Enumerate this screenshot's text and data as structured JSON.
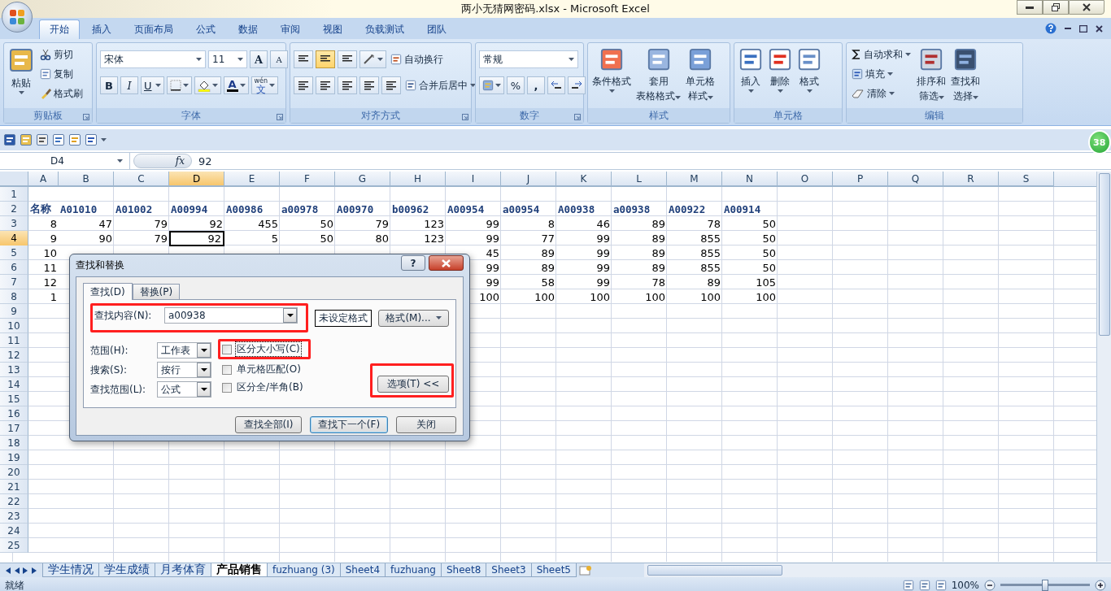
{
  "title_bar": {
    "title": "两小无猜网密码.xlsx - Microsoft Excel"
  },
  "ribbon_tabs": [
    {
      "label": "开始",
      "selected": true
    },
    {
      "label": "插入",
      "selected": false
    },
    {
      "label": "页面布局",
      "selected": false
    },
    {
      "label": "公式",
      "selected": false
    },
    {
      "label": "数据",
      "selected": false
    },
    {
      "label": "审阅",
      "selected": false
    },
    {
      "label": "视图",
      "selected": false
    },
    {
      "label": "负载测试",
      "selected": false
    },
    {
      "label": "团队",
      "selected": false
    }
  ],
  "clipboard": {
    "label": "剪贴板",
    "paste": "粘贴",
    "cut": "剪切",
    "copy": "复制",
    "format_painter": "格式刷"
  },
  "font": {
    "label": "字体",
    "name": "宋体",
    "size": "11",
    "grow": "A",
    "shrink": "A",
    "bold": "B",
    "italic": "I",
    "underline": "U",
    "color_letter": "A",
    "phonetic_top": "wén",
    "phonetic": "文"
  },
  "alignment": {
    "label": "对齐方式",
    "wrap": "自动换行",
    "merge": "合并后居中",
    "vertical": [
      {
        "selected": false
      },
      {
        "selected": true
      },
      {
        "selected": false
      }
    ]
  },
  "number": {
    "label": "数字",
    "format": "常规",
    "percent": "%",
    "comma": ","
  },
  "styles": {
    "label": "样式",
    "buttons": [
      {
        "lines": [
          "条件格式"
        ]
      },
      {
        "lines": [
          "套用",
          "表格格式"
        ]
      },
      {
        "lines": [
          "单元格",
          "样式"
        ]
      }
    ]
  },
  "cells": {
    "label": "单元格",
    "buttons": [
      "插入",
      "删除",
      "格式"
    ]
  },
  "editing": {
    "label": "编辑",
    "autosum": "自动求和",
    "fill": "填充",
    "clear": "清除",
    "sort": [
      "排序和",
      "筛选"
    ],
    "find": [
      "查找和",
      "选择"
    ]
  },
  "formula_bar": {
    "name_box": "D4",
    "fx": "fx",
    "value": "92"
  },
  "side_badge": "38",
  "columns": [
    {
      "label": "A",
      "selected": false
    },
    {
      "label": "B",
      "selected": false
    },
    {
      "label": "C",
      "selected": false
    },
    {
      "label": "D",
      "selected": true
    },
    {
      "label": "E",
      "selected": false
    },
    {
      "label": "F",
      "selected": false
    },
    {
      "label": "G",
      "selected": false
    },
    {
      "label": "H",
      "selected": false
    },
    {
      "label": "I",
      "selected": false
    },
    {
      "label": "J",
      "selected": false
    },
    {
      "label": "K",
      "selected": false
    },
    {
      "label": "L",
      "selected": false
    },
    {
      "label": "M",
      "selected": false
    },
    {
      "label": "N",
      "selected": false
    },
    {
      "label": "O",
      "selected": false
    },
    {
      "label": "P",
      "selected": false
    },
    {
      "label": "Q",
      "selected": false
    },
    {
      "label": "R",
      "selected": false
    },
    {
      "label": "S",
      "selected": false
    }
  ],
  "rows": [
    {
      "label": "1",
      "selected": false,
      "kind": "data"
    },
    {
      "label": "2",
      "selected": false,
      "kind": "header",
      "cells": [
        "名称",
        "A01010",
        "A01002",
        "A00994",
        "A00986",
        "a00978",
        "A00970",
        "b00962",
        "A00954",
        "a00954",
        "A00938",
        "a00938",
        "A00922",
        "A00914"
      ]
    },
    {
      "label": "3",
      "selected": false,
      "kind": "data",
      "cells": [
        "8",
        "47",
        "79",
        "92",
        "455",
        "50",
        "79",
        "123",
        "99",
        "8",
        "46",
        "89",
        "78",
        "50"
      ]
    },
    {
      "label": "4",
      "selected": true,
      "kind": "data",
      "cells": [
        "9",
        "90",
        "79",
        "92",
        "5",
        "50",
        "80",
        "123",
        "99",
        "77",
        "99",
        "89",
        "855",
        "50"
      ]
    },
    {
      "label": "5",
      "selected": false,
      "kind": "data",
      "cells": [
        "10",
        null,
        null,
        null,
        null,
        null,
        null,
        null,
        "45",
        "89",
        "99",
        "89",
        "855",
        "50"
      ]
    },
    {
      "label": "6",
      "selected": false,
      "kind": "data",
      "cells": [
        "11",
        null,
        null,
        null,
        null,
        null,
        null,
        null,
        "99",
        "89",
        "99",
        "89",
        "855",
        "50"
      ]
    },
    {
      "label": "7",
      "selected": false,
      "kind": "data",
      "cells": [
        "12",
        null,
        null,
        null,
        null,
        null,
        null,
        null,
        "99",
        "58",
        "99",
        "78",
        "89",
        "105"
      ]
    },
    {
      "label": "8",
      "selected": false,
      "kind": "data",
      "cells": [
        "1",
        null,
        null,
        null,
        null,
        null,
        null,
        null,
        "100",
        "100",
        "100",
        "100",
        "100",
        "100"
      ]
    },
    {
      "label": "9",
      "selected": false,
      "kind": "data"
    },
    {
      "label": "10",
      "selected": false,
      "kind": "data"
    },
    {
      "label": "11",
      "selected": false,
      "kind": "data"
    },
    {
      "label": "12",
      "selected": false,
      "kind": "data"
    },
    {
      "label": "13",
      "selected": false,
      "kind": "data"
    },
    {
      "label": "14",
      "selected": false,
      "kind": "data"
    },
    {
      "label": "15",
      "selected": false,
      "kind": "data"
    },
    {
      "label": "16",
      "selected": false,
      "kind": "data"
    },
    {
      "label": "17",
      "selected": false,
      "kind": "data"
    },
    {
      "label": "18",
      "selected": false,
      "kind": "data"
    },
    {
      "label": "19",
      "selected": false,
      "kind": "data"
    },
    {
      "label": "20",
      "selected": false,
      "kind": "data"
    },
    {
      "label": "21",
      "selected": false,
      "kind": "data"
    },
    {
      "label": "22",
      "selected": false,
      "kind": "data"
    },
    {
      "label": "23",
      "selected": false,
      "kind": "data"
    },
    {
      "label": "24",
      "selected": false,
      "kind": "data"
    },
    {
      "label": "25",
      "selected": false,
      "kind": "data"
    }
  ],
  "sheet_tabs": [
    {
      "label": "学生情况",
      "selected": false
    },
    {
      "label": "学生成绩",
      "selected": false
    },
    {
      "label": "月考体育",
      "selected": false
    },
    {
      "label": "产品销售",
      "selected": true
    },
    {
      "label": "fuzhuang (3)",
      "selected": false
    },
    {
      "label": "Sheet4",
      "selected": false
    },
    {
      "label": "fuzhuang",
      "selected": false
    },
    {
      "label": "Sheet8",
      "selected": false
    },
    {
      "label": "Sheet3",
      "selected": false
    },
    {
      "label": "Sheet5",
      "selected": false
    }
  ],
  "status_bar": {
    "text": "就绪",
    "zoom": "100%",
    "zoom_slider": {
      "level": 0.5
    }
  },
  "dialog": {
    "title": "查找和替换",
    "help": "?",
    "tabs": [
      {
        "label": "查找(D)",
        "selected": true
      },
      {
        "label": "替换(P)",
        "selected": false
      }
    ],
    "find_label": "查找内容(N):",
    "find_value": "a00938",
    "find_highlighted": true,
    "format_preview": "未设定格式",
    "format_button": "格式(M)...",
    "options": [
      {
        "label": "范围(H):",
        "value": "工作表"
      },
      {
        "label": "搜索(S):",
        "value": "按行"
      },
      {
        "label": "查找范围(L):",
        "value": "公式"
      }
    ],
    "checkboxes": [
      {
        "label": "区分大小写(C)",
        "checked": false,
        "focused": true,
        "highlighted": true
      },
      {
        "label": "单元格匹配(O)",
        "checked": false,
        "focused": false,
        "highlighted": false
      },
      {
        "label": "区分全/半角(B)",
        "checked": false,
        "focused": false,
        "highlighted": false
      }
    ],
    "options_button": "选项(T) <<",
    "options_highlighted": true,
    "buttons": [
      {
        "label": "查找全部(I)",
        "default": false
      },
      {
        "label": "查找下一个(F)",
        "default": true
      },
      {
        "label": "关闭",
        "default": false
      }
    ]
  }
}
